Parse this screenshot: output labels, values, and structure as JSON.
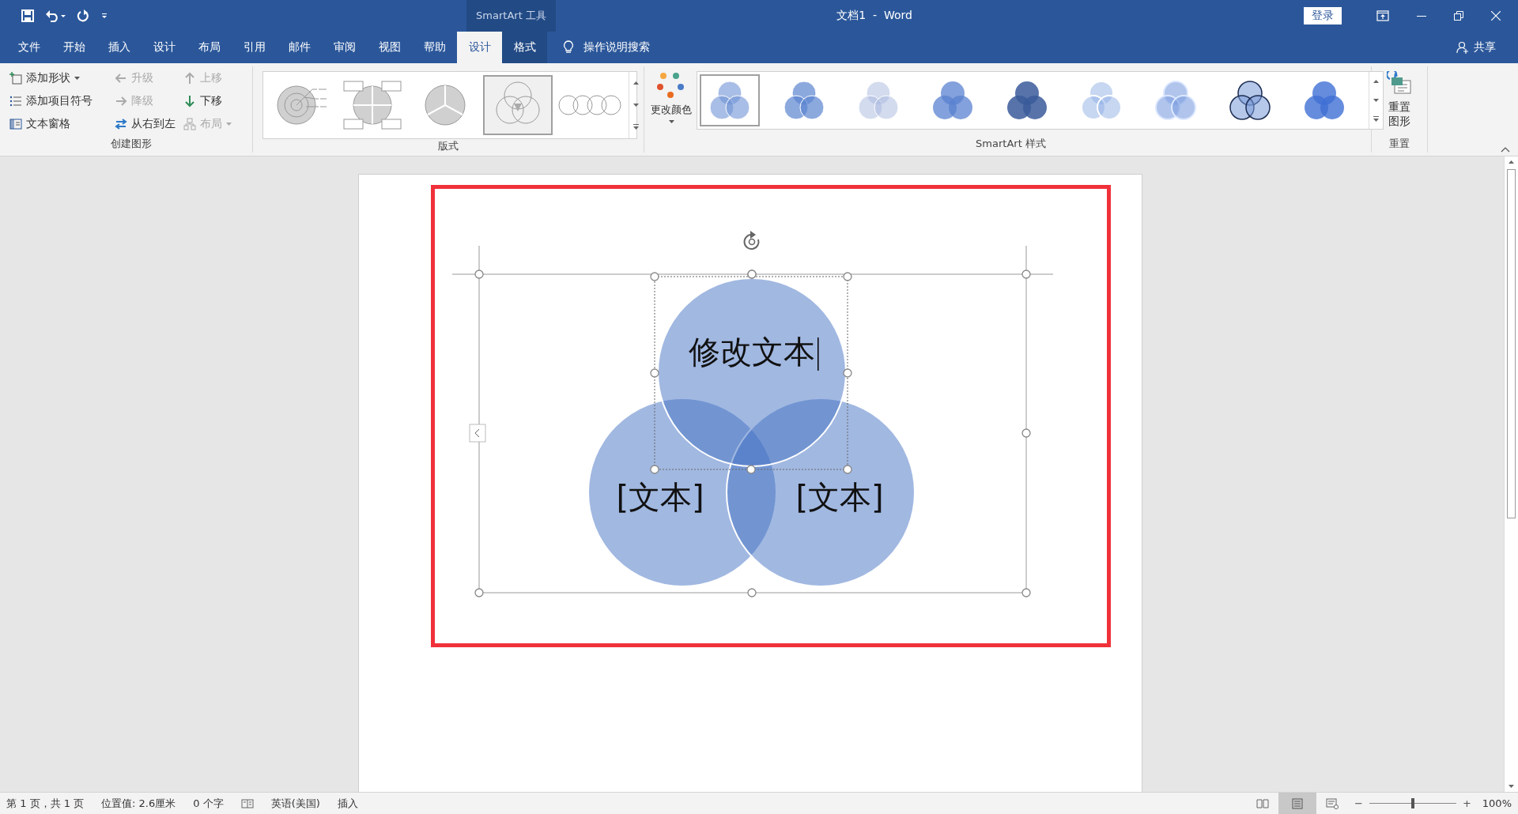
{
  "title_bar": {
    "context_group": "SmartArt 工具",
    "title": "文档1  -  Word",
    "login_button": "登录"
  },
  "tabs": [
    {
      "label": "文件",
      "kind": "normal",
      "selected": false
    },
    {
      "label": "开始",
      "kind": "normal",
      "selected": false
    },
    {
      "label": "插入",
      "kind": "normal",
      "selected": false
    },
    {
      "label": "设计",
      "kind": "normal",
      "selected": false
    },
    {
      "label": "布局",
      "kind": "normal",
      "selected": false
    },
    {
      "label": "引用",
      "kind": "normal",
      "selected": false
    },
    {
      "label": "邮件",
      "kind": "normal",
      "selected": false
    },
    {
      "label": "审阅",
      "kind": "normal",
      "selected": false
    },
    {
      "label": "视图",
      "kind": "normal",
      "selected": false
    },
    {
      "label": "帮助",
      "kind": "normal",
      "selected": false
    },
    {
      "label": "设计",
      "kind": "context",
      "selected": true
    },
    {
      "label": "格式",
      "kind": "context",
      "selected": false
    }
  ],
  "tell_me": {
    "placeholder": "操作说明搜索"
  },
  "share_button": "共享",
  "ribbon": {
    "create_graphic": {
      "label": "创建图形",
      "columns": [
        [
          {
            "label": "添加形状",
            "disabled": false,
            "dropdown": true
          },
          {
            "label": "添加项目符号",
            "disabled": false,
            "dropdown": false
          },
          {
            "label": "文本窗格",
            "disabled": false,
            "dropdown": false
          }
        ],
        [
          {
            "label": "升级",
            "disabled": true,
            "dropdown": false
          },
          {
            "label": "降级",
            "disabled": true,
            "dropdown": false
          },
          {
            "label": "从右到左",
            "disabled": false,
            "dropdown": false
          }
        ],
        [
          {
            "label": "上移",
            "disabled": true,
            "dropdown": false
          },
          {
            "label": "下移",
            "disabled": false,
            "dropdown": false
          },
          {
            "label": "布局",
            "disabled": true,
            "dropdown": true
          }
        ]
      ]
    },
    "layouts": {
      "label": "版式",
      "items": [
        {
          "selected": false
        },
        {
          "selected": false
        },
        {
          "selected": false
        },
        {
          "selected": true
        },
        {
          "selected": false
        }
      ]
    },
    "styles": {
      "label": "SmartArt 样式",
      "change_colors": "更改颜色",
      "items": [
        {
          "selected": true
        },
        {
          "selected": false
        },
        {
          "selected": false
        },
        {
          "selected": false
        },
        {
          "selected": false
        },
        {
          "selected": false
        },
        {
          "selected": false
        },
        {
          "selected": false
        },
        {
          "selected": false
        }
      ]
    },
    "reset": {
      "label": "重置",
      "button": "重置图形"
    }
  },
  "document": {
    "smartart_texts": [
      "修改文本",
      "[文本]",
      "[文本]"
    ]
  },
  "status_bar": {
    "left": [
      "第 1 页，共 1 页",
      "位置值: 2.6厘米",
      "0 个字"
    ],
    "language": "英语(美国)",
    "mode": "插入",
    "zoom_out": "−",
    "zoom_in": "+",
    "zoom": {
      "level": 0.5
    },
    "zoom_reading": "100%"
  }
}
